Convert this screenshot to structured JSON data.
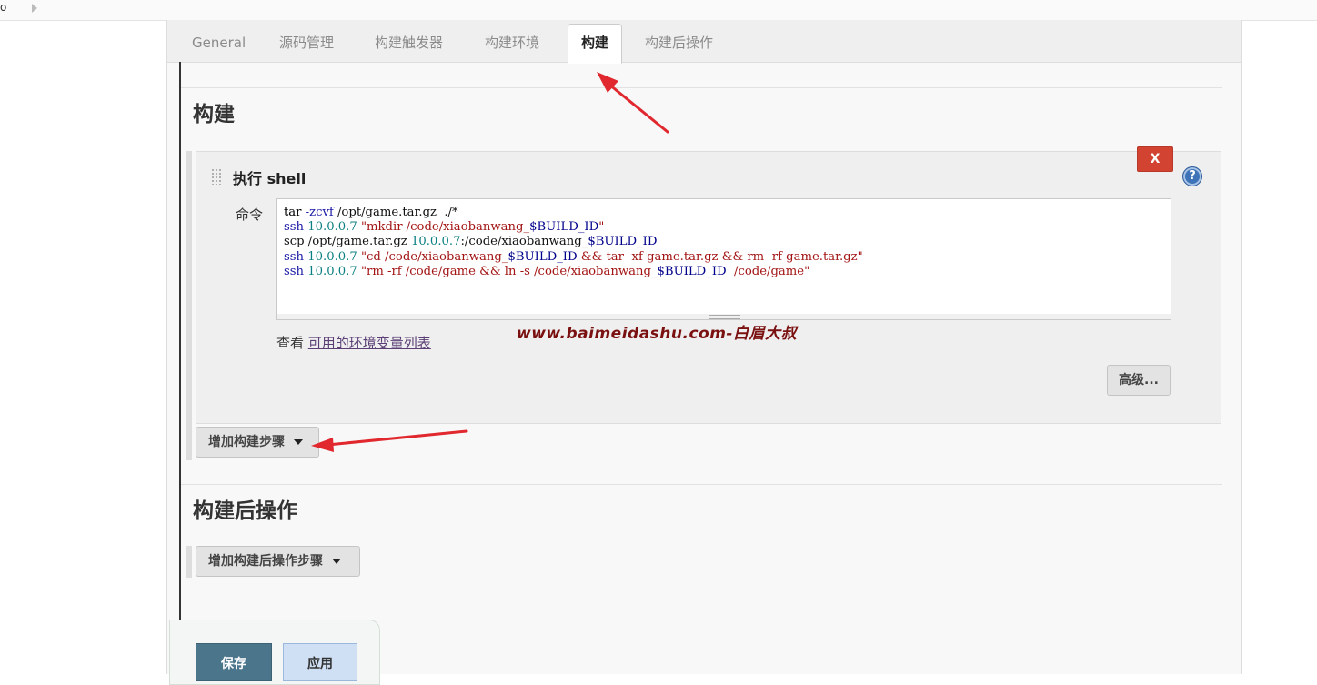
{
  "topbar": {
    "left_text": "o"
  },
  "tabs": [
    {
      "label": "General"
    },
    {
      "label": "源码管理"
    },
    {
      "label": "构建触发器"
    },
    {
      "label": "构建环境"
    },
    {
      "label": "构建",
      "active": true
    },
    {
      "label": "构建后操作"
    }
  ],
  "build_section": {
    "title": "构建",
    "step": {
      "title": "执行 shell",
      "delete_label": "X",
      "help_label": "?",
      "command_label": "命令",
      "command_lines": [
        "tar -zcvf /opt/game.tar.gz  ./*",
        "ssh 10.0.0.7 \"mkdir /code/xiaobanwang_$BUILD_ID\"",
        "scp /opt/game.tar.gz 10.0.0.7:/code/xiaobanwang_$BUILD_ID",
        "ssh 10.0.0.7 \"cd /code/xiaobanwang_$BUILD_ID && tar -xf game.tar.gz && rm -rf game.tar.gz\"",
        "ssh 10.0.0.7 \"rm -rf /code/game && ln -s /code/xiaobanwang_$BUILD_ID  /code/game\""
      ],
      "view_prefix": "查看",
      "env_link": "可用的环境变量列表",
      "advanced_label": "高级..."
    },
    "add_step_label": "增加构建步骤"
  },
  "post_build_section": {
    "title": "构建后操作",
    "add_step_label": "增加构建后操作步骤"
  },
  "watermark": "www.baimeidashu.com-白眉大叔",
  "footer": {
    "save_label": "保存",
    "apply_label": "应用"
  },
  "colors": {
    "accent_red": "#e0282e",
    "delete_red": "#d24332",
    "save_blue": "#4b758b",
    "apply_blue": "#cfe0f5"
  }
}
